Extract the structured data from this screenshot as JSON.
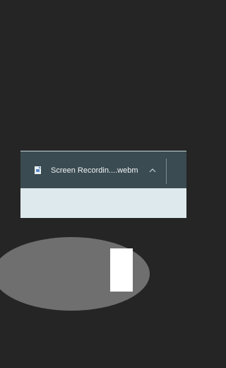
{
  "download_shelf": {
    "item": {
      "filename": "Screen Recordin....webm",
      "file_icon": "document-icon",
      "expand_icon": "chevron-up-icon"
    }
  },
  "colors": {
    "page_background": "#252525",
    "shelf_bar": "#3a4b51",
    "shelf_bottom": "#dde9ec",
    "filename_text": "#f1f4f5",
    "icon_blue": "#5b88c8",
    "blur_shape": "#6f6f6f"
  }
}
